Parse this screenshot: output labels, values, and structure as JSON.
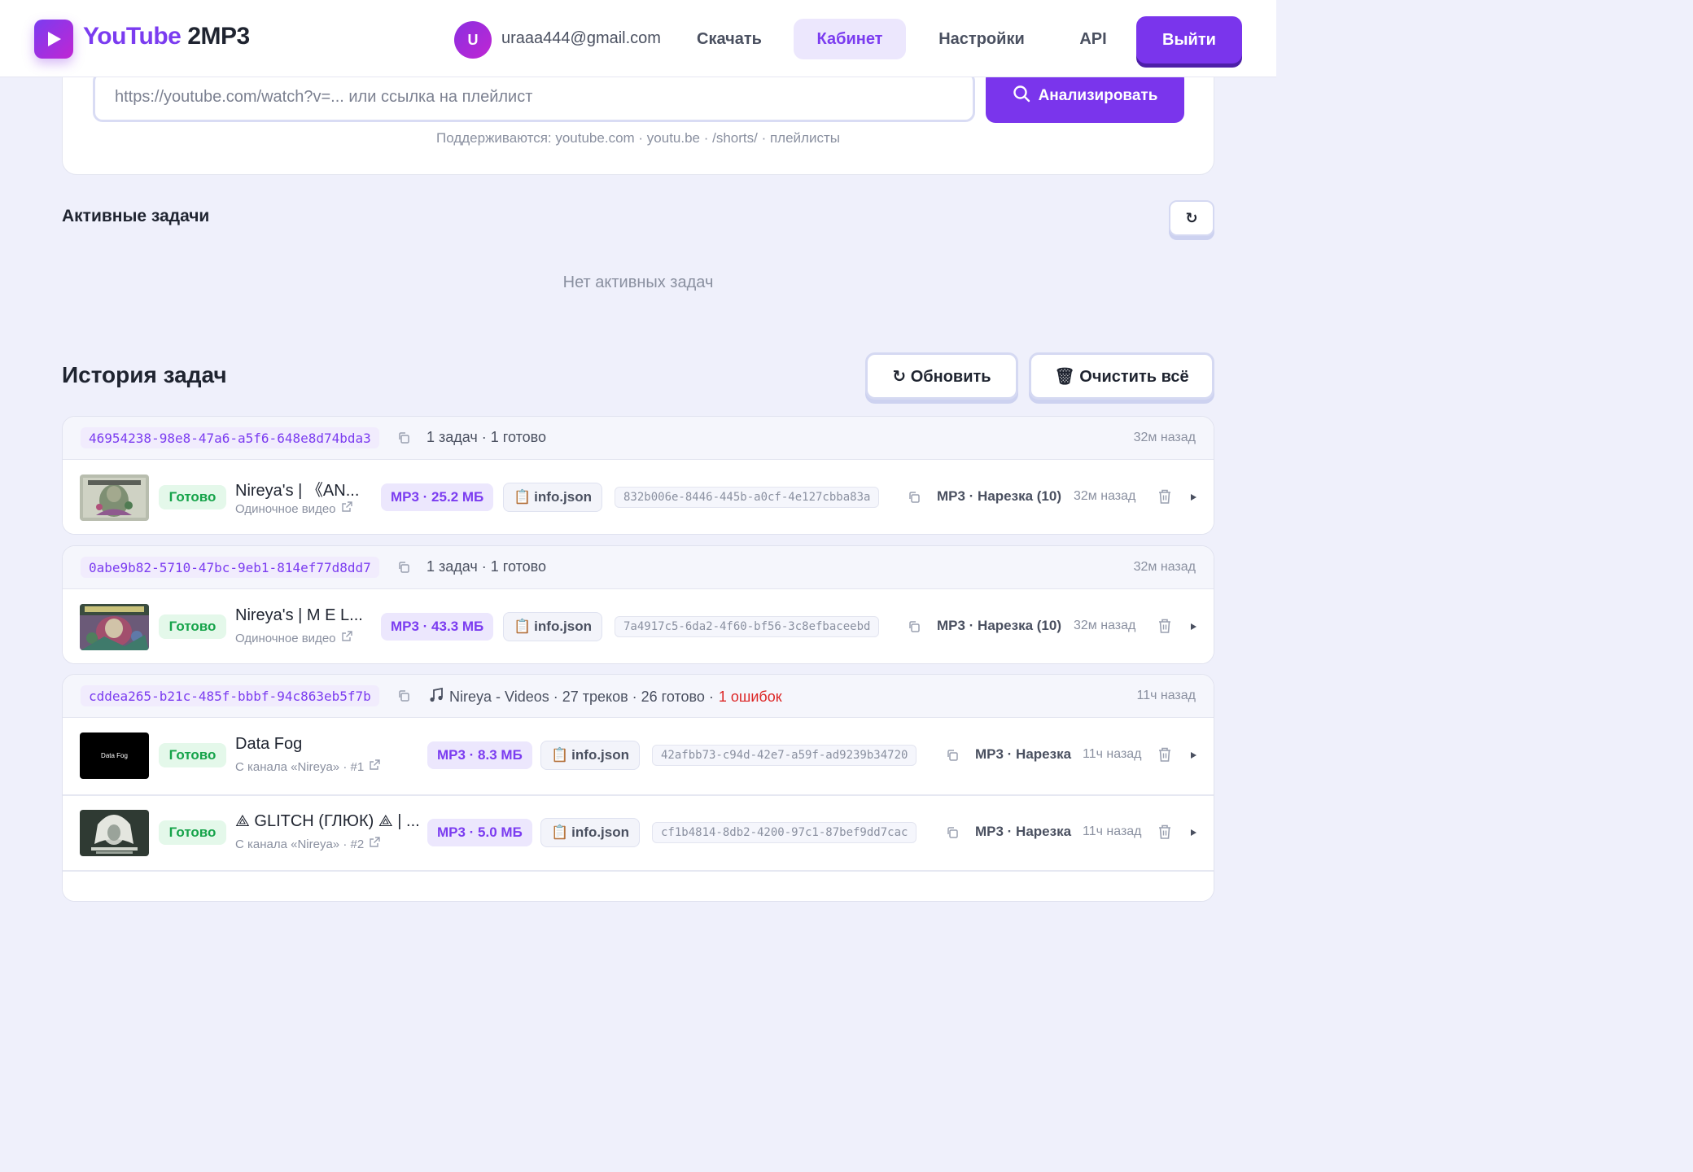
{
  "header": {
    "logo_youtube": "YouTube",
    "logo_2mp3": "2MP3",
    "avatar_letter": "U",
    "email": "uraaa444@gmail.com",
    "nav": {
      "download": "Скачать",
      "cabinet": "Кабинет",
      "settings": "Настройки",
      "api": "API"
    },
    "logout": "Выйти",
    "accent_color": "#7a35ec"
  },
  "url_form": {
    "placeholder": "https://youtube.com/watch?v=... или ссылка на плейлист",
    "analyze_label": "Анализировать",
    "supported": "Поддерживаются: youtube.com · youtu.be · /shorts/ · плейлисты"
  },
  "active_tasks": {
    "title": "Активные задачи",
    "refresh_icon": "↻",
    "empty": "Нет активных задач"
  },
  "history": {
    "title": "История задач",
    "refresh_label": "↻ Обновить",
    "clear_label": "🗑 Очистить всё",
    "groups": [
      {
        "id": "46954238-98e8-47a6-a5f6-648e8d74bda3",
        "summary": "1 задач · 1 готово",
        "time": "32м назад",
        "rows": [
          {
            "status": "Готово",
            "title": "Nireya's | 《AN...",
            "subtitle": "Одиночное видео",
            "mp3": "MP3 · 25.2 МБ",
            "info": "info.json",
            "uuid": "832b006e-8446-445b-a0cf-4e127cbba83a",
            "format": "MP3 · Нарезка (10)",
            "time": "32м назад"
          }
        ]
      },
      {
        "id": "0abe9b82-5710-47bc-9eb1-814ef77d8dd7",
        "summary": "1 задач · 1 готово",
        "time": "32м назад",
        "rows": [
          {
            "status": "Готово",
            "title": "Nireya's | M E L...",
            "subtitle": "Одиночное видео",
            "mp3": "MP3 · 43.3 МБ",
            "info": "info.json",
            "uuid": "7a4917c5-6da2-4f60-bf56-3c8efbaceebd",
            "format": "MP3 · Нарезка (10)",
            "time": "32м назад"
          }
        ]
      },
      {
        "id": "cddea265-b21c-485f-bbbf-94c863eb5f7b",
        "summary": "Nireya - Videos · 27 треков · 26 готово ·",
        "errors": "1 ошибок",
        "time": "11ч назад",
        "rows": [
          {
            "status": "Готово",
            "title": "Data Fog",
            "thumb_text": "Data Fog",
            "subtitle": "С канала «Nireya» · #1",
            "mp3": "MP3 · 8.3 МБ",
            "info": "info.json",
            "uuid": "42afbb73-c94d-42e7-a59f-ad9239b34720",
            "format": "MP3 · Нарезка",
            "time": "11ч назад"
          },
          {
            "status": "Готово",
            "title": "⟁ GLITCH (ГЛЮК) ⟁ | ...",
            "subtitle": "С канала «Nireya» · #2",
            "mp3": "MP3 · 5.0 МБ",
            "info": "info.json",
            "uuid": "cf1b4814-8db2-4200-97c1-87bef9dd7cac",
            "format": "MP3 · Нарезка",
            "time": "11ч назад"
          }
        ]
      }
    ]
  }
}
